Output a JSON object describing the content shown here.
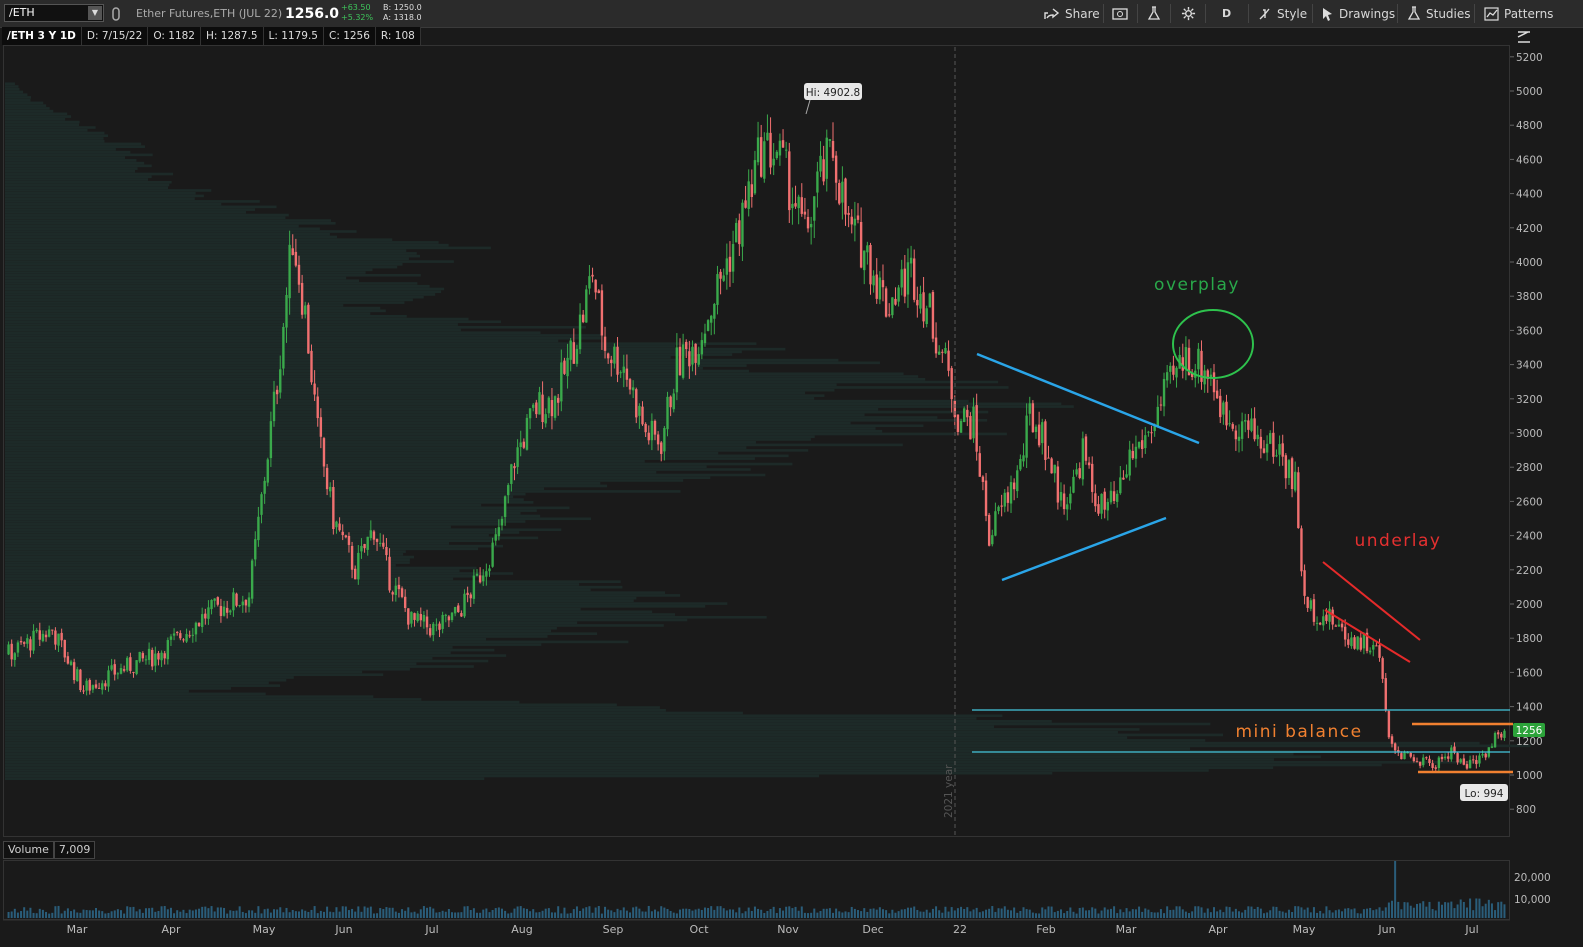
{
  "toolbar": {
    "symbol": "/ETH",
    "description": "Ether Futures,ETH (JUL 22)",
    "last": "1256.0",
    "change_abs": "+63.50",
    "change_pct": "+5.32%",
    "bid": "B: 1250.0",
    "ask": "A: 1318.0",
    "share_label": "Share",
    "aggregation_label": "D",
    "style_label": "Style",
    "drawings_label": "Drawings",
    "studies_label": "Studies",
    "patterns_label": "Patterns",
    "icons": [
      "link-icon",
      "share-icon",
      "snapshot-icon",
      "flask-icon",
      "gear-icon",
      "style-icon",
      "cursor-icon",
      "studies-icon",
      "patterns-icon",
      "collapse-icon"
    ]
  },
  "info_bar": {
    "symbol_period": "/ETH 3 Y 1D",
    "date": "D: 7/15/22",
    "open": "O: 1182",
    "high": "H: 1287.5",
    "low": "L: 1179.5",
    "close": "C: 1256",
    "range": "R: 108"
  },
  "chart_data": {
    "type": "candlestick",
    "y_axis": {
      "min": 700,
      "max": 5300,
      "ticks": [
        800,
        1000,
        1200,
        1400,
        1600,
        1800,
        2000,
        2200,
        2400,
        2600,
        2800,
        3000,
        3200,
        3400,
        3600,
        3800,
        4000,
        4200,
        4400,
        4600,
        4800,
        5000,
        5200
      ]
    },
    "x_axis": {
      "labels": [
        "Mar",
        "Apr",
        "May",
        "Jun",
        "Jul",
        "Aug",
        "Sep",
        "Oct",
        "Nov",
        "Dec",
        "22",
        "Feb",
        "Mar",
        "Apr",
        "May",
        "Jun",
        "Jul"
      ]
    },
    "price_path": [
      [
        0,
        1700
      ],
      [
        15,
        1850
      ],
      [
        25,
        1500
      ],
      [
        35,
        1600
      ],
      [
        48,
        1700
      ],
      [
        55,
        1800
      ],
      [
        65,
        1950
      ],
      [
        78,
        2050
      ],
      [
        83,
        2750
      ],
      [
        87,
        3300
      ],
      [
        92,
        4150
      ],
      [
        96,
        3700
      ],
      [
        100,
        3000
      ],
      [
        105,
        2500
      ],
      [
        112,
        2200
      ],
      [
        118,
        2450
      ],
      [
        123,
        2150
      ],
      [
        130,
        1900
      ],
      [
        138,
        1850
      ],
      [
        145,
        1950
      ],
      [
        150,
        2100
      ],
      [
        158,
        2400
      ],
      [
        163,
        2850
      ],
      [
        170,
        3150
      ],
      [
        176,
        3200
      ],
      [
        180,
        3400
      ],
      [
        185,
        3700
      ],
      [
        188,
        3950
      ],
      [
        192,
        3500
      ],
      [
        198,
        3400
      ],
      [
        205,
        3000
      ],
      [
        210,
        2950
      ],
      [
        215,
        3400
      ],
      [
        222,
        3550
      ],
      [
        228,
        3850
      ],
      [
        235,
        4200
      ],
      [
        242,
        4650
      ],
      [
        247,
        4650
      ],
      [
        252,
        4400
      ],
      [
        256,
        4150
      ],
      [
        260,
        4450
      ],
      [
        265,
        4650
      ],
      [
        270,
        4200
      ],
      [
        276,
        4050
      ],
      [
        282,
        3750
      ],
      [
        290,
        3950
      ],
      [
        296,
        3700
      ],
      [
        301,
        3400
      ],
      [
        305,
        3100
      ],
      [
        310,
        3050
      ],
      [
        315,
        2400
      ],
      [
        320,
        2600
      ],
      [
        325,
        2800
      ],
      [
        328,
        3100
      ],
      [
        332,
        3000
      ],
      [
        338,
        2600
      ],
      [
        342,
        2700
      ],
      [
        345,
        2900
      ],
      [
        348,
        2650
      ],
      [
        352,
        2550
      ],
      [
        356,
        2600
      ],
      [
        360,
        2850
      ],
      [
        366,
        3000
      ],
      [
        372,
        3250
      ],
      [
        378,
        3450
      ],
      [
        382,
        3400
      ],
      [
        386,
        3350
      ],
      [
        390,
        3100
      ],
      [
        396,
        3050
      ],
      [
        402,
        2950
      ],
      [
        408,
        2900
      ],
      [
        413,
        2700
      ],
      [
        416,
        2000
      ],
      [
        420,
        1950
      ],
      [
        425,
        1900
      ],
      [
        430,
        1800
      ],
      [
        435,
        1780
      ],
      [
        440,
        1700
      ],
      [
        443,
        1200
      ],
      [
        448,
        1100
      ],
      [
        453,
        1080
      ],
      [
        458,
        1060
      ],
      [
        463,
        1150
      ],
      [
        467,
        1050
      ],
      [
        472,
        1100
      ],
      [
        476,
        1180
      ],
      [
        478,
        1256
      ]
    ],
    "total_days": 480,
    "high_label": "Hi: 4902.8",
    "low_label": "Lo: 994",
    "last_price_label": "1256",
    "year_marker": "2021 year",
    "annotations": [
      {
        "text": "overplay",
        "color": "#29a84a"
      },
      {
        "text": "underlay",
        "color": "#e53030"
      },
      {
        "text": "mini balance",
        "color": "#f08030"
      }
    ],
    "colors": {
      "up": "#3aa94b",
      "down": "#f07070",
      "triangle": "#2aa5e8",
      "channel": "#e52a2a",
      "balance": "#f08030",
      "level": "#45c7dd",
      "circle": "#2ec24d"
    }
  },
  "volume": {
    "label": "Volume",
    "value": "7,009",
    "ticks": [
      "20,000",
      "10,000"
    ]
  }
}
